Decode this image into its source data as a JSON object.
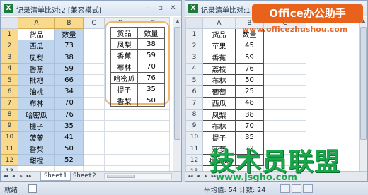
{
  "left_window": {
    "title": "记录清单比对:2  [兼容模式]",
    "columns": [
      "A",
      "B",
      "C",
      "D",
      "E"
    ],
    "rows": [
      {
        "n": "1",
        "a": "货品",
        "b": "数量"
      },
      {
        "n": "2",
        "a": "西瓜",
        "b": "73"
      },
      {
        "n": "3",
        "a": "凤梨",
        "b": "38"
      },
      {
        "n": "4",
        "a": "香蕉",
        "b": "59"
      },
      {
        "n": "5",
        "a": "枇杷",
        "b": "66"
      },
      {
        "n": "6",
        "a": "油桃",
        "b": "34"
      },
      {
        "n": "7",
        "a": "布林",
        "b": "70"
      },
      {
        "n": "8",
        "a": "哈密瓜",
        "b": "76"
      },
      {
        "n": "9",
        "a": "提子",
        "b": "35"
      },
      {
        "n": "10",
        "a": "菠萝",
        "b": "41"
      },
      {
        "n": "11",
        "a": "香梨",
        "b": "50"
      },
      {
        "n": "12",
        "a": "甜橙",
        "b": "52"
      },
      {
        "n": "13",
        "a": "",
        "b": ""
      }
    ],
    "floating_table": [
      [
        "货品",
        "数量"
      ],
      [
        "凤梨",
        "38"
      ],
      [
        "香蕉",
        "59"
      ],
      [
        "布林",
        "70"
      ],
      [
        "哈密瓜",
        "76"
      ],
      [
        "提子",
        "35"
      ],
      [
        "香梨",
        "50"
      ]
    ],
    "sheet_tabs": [
      "Sheet1",
      "Sheet2"
    ],
    "active_tab": "Sheet1"
  },
  "right_window": {
    "title": "记录清单比对:1  [兼容模",
    "columns": [
      "A",
      "B",
      "C"
    ],
    "rows": [
      {
        "n": "1",
        "a": "货品",
        "b": "数量"
      },
      {
        "n": "2",
        "a": "苹果",
        "b": "45"
      },
      {
        "n": "3",
        "a": "香蕉",
        "b": "59"
      },
      {
        "n": "4",
        "a": "荔枝",
        "b": "76"
      },
      {
        "n": "5",
        "a": "布林",
        "b": "50"
      },
      {
        "n": "6",
        "a": "葡萄",
        "b": "25"
      },
      {
        "n": "7",
        "a": "西瓜",
        "b": "48"
      },
      {
        "n": "8",
        "a": "凤梨",
        "b": "38"
      },
      {
        "n": "9",
        "a": "布林",
        "b": "70"
      },
      {
        "n": "10",
        "a": "提子",
        "b": "35"
      },
      {
        "n": "11",
        "a": "菠萝",
        "b": "72"
      },
      {
        "n": "12",
        "a": "哈密瓜",
        "b": "76"
      },
      {
        "n": "13",
        "a": "",
        "b": ""
      }
    ]
  },
  "window_controls": {
    "minimize": "–",
    "restore": "▫",
    "close": "✕"
  },
  "tab_nav": [
    "◂◂",
    "◂",
    "▸",
    "▸▸"
  ],
  "status": {
    "ready": "就绪",
    "average": "平均值: 54",
    "count": "计数: 24"
  },
  "brand": {
    "badge": "Office办公助手",
    "url": "www.officezhushou.com"
  },
  "watermark": {
    "text": "技术员联盟",
    "url": "www.jsgho.com"
  },
  "colors": {
    "selection": "#bfd5ee",
    "header_selected": "#f9d98b",
    "floating_border": "#f2b66d",
    "brand_orange": "#e8621c",
    "watermark_green": "#1aa64a"
  }
}
